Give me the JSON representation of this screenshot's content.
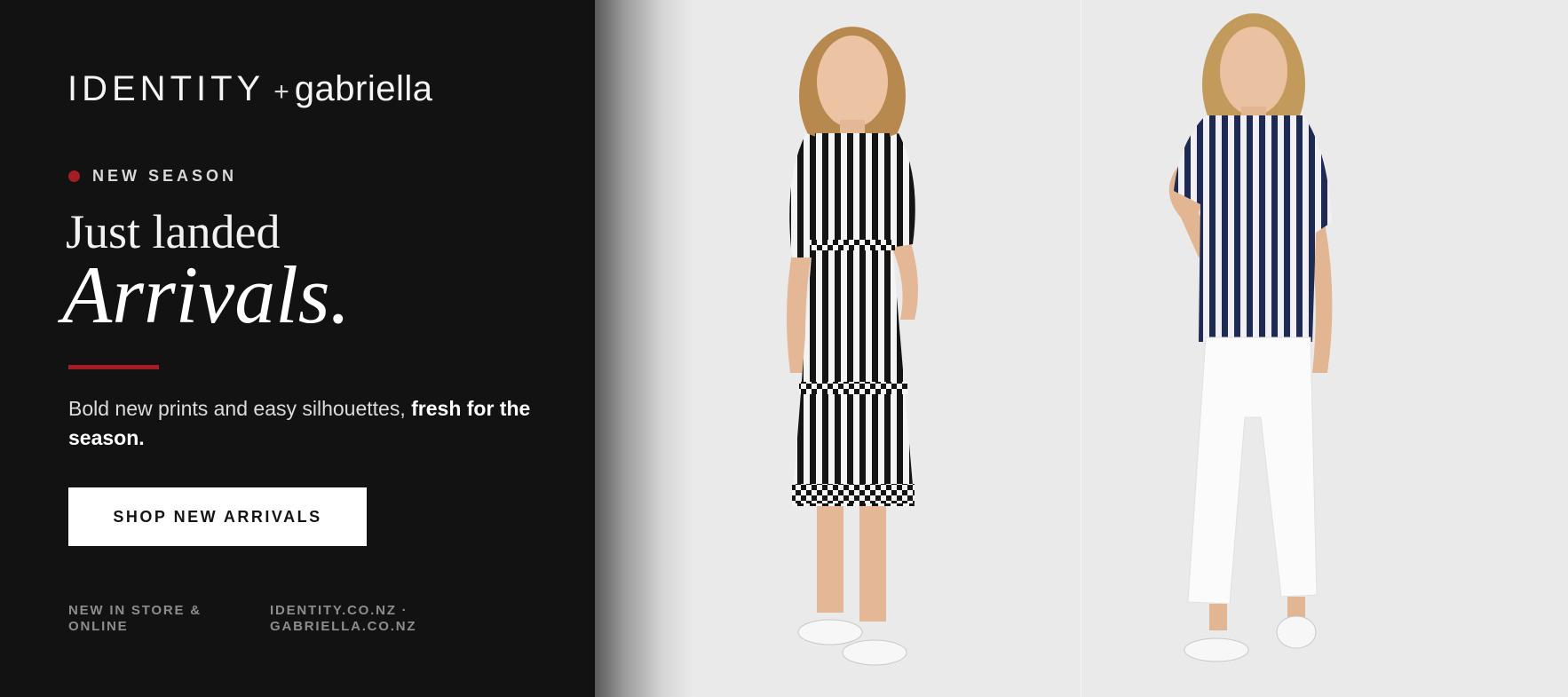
{
  "brand": {
    "primary": "IDENTITY",
    "plus": "+",
    "secondary": "gabriella"
  },
  "tag": {
    "label": "NEW SEASON",
    "dot_color": "#a51d24"
  },
  "headline": {
    "line1": "Just landed",
    "line2": "Arrivals."
  },
  "blurb": {
    "text": "Bold new prints and easy silhouettes, ",
    "emphasis": "fresh for the season."
  },
  "cta": {
    "label": "SHOP NEW ARRIVALS"
  },
  "footer": {
    "availability": "NEW IN STORE & ONLINE",
    "sites": "IDENTITY.CO.NZ · GABRIELLA.CO.NZ"
  },
  "colors": {
    "accent": "#a51d24",
    "panel_bg": "#121213",
    "photo_bg": "#ebeaea"
  },
  "photos": [
    {
      "icon": "model-striped-dress-image"
    },
    {
      "icon": "model-striped-top-white-pants-image"
    }
  ]
}
